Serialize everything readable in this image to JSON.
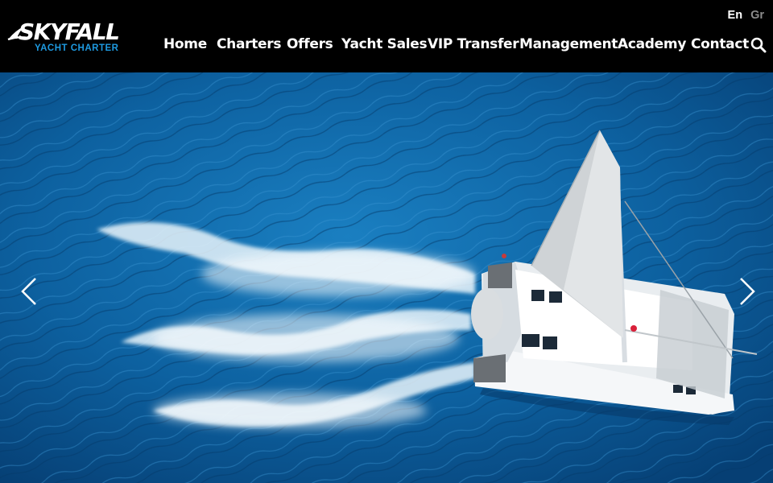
{
  "brand": {
    "name": "SKYFALL",
    "tagline": "YACHT CHARTER"
  },
  "language": {
    "items": [
      "En",
      "Gr"
    ],
    "active": "En"
  },
  "nav": {
    "items": [
      {
        "label": "Home"
      },
      {
        "label": "Charters"
      },
      {
        "label": "Offers"
      },
      {
        "label": "Yacht Sales"
      },
      {
        "label": "VIP Transfer"
      },
      {
        "label": "Management"
      },
      {
        "label": "Academy"
      },
      {
        "label": "Contact"
      }
    ]
  },
  "icons": {
    "search": "search-icon",
    "prev": "chevron-left-icon",
    "next": "chevron-right-icon"
  },
  "colors": {
    "header_bg": "#000000",
    "accent": "#1e9ae0",
    "inactive_lang": "#8c8c8c",
    "sea": "#0b5a94"
  }
}
